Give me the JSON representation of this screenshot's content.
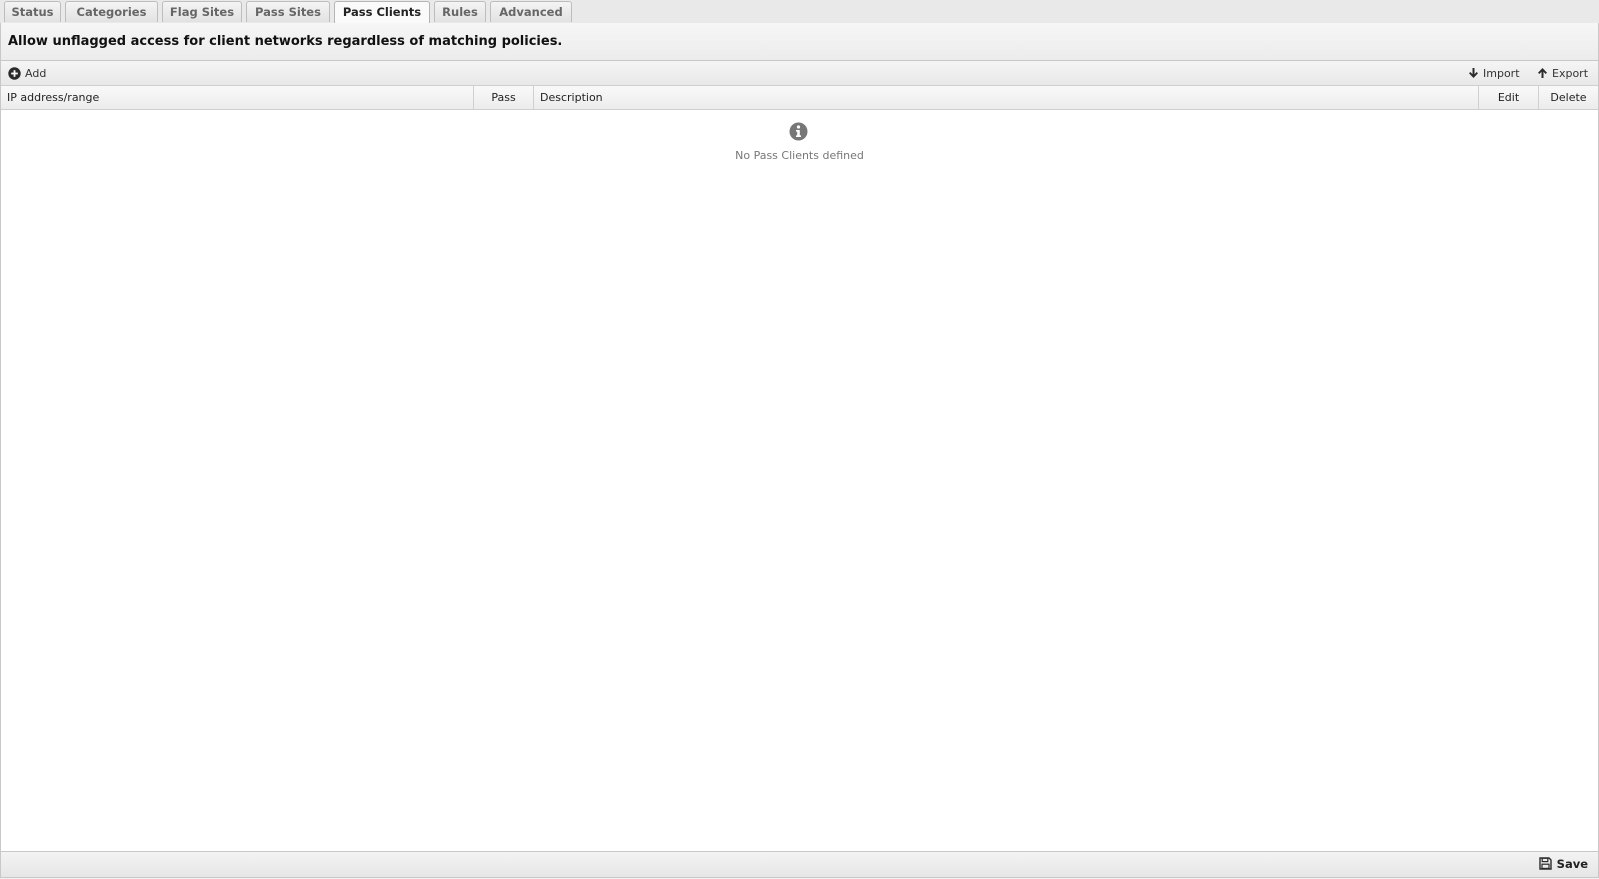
{
  "tabs": [
    {
      "label": "Status",
      "active": false
    },
    {
      "label": "Categories",
      "active": false
    },
    {
      "label": "Flag Sites",
      "active": false
    },
    {
      "label": "Pass Sites",
      "active": false
    },
    {
      "label": "Pass Clients",
      "active": true
    },
    {
      "label": "Rules",
      "active": false
    },
    {
      "label": "Advanced",
      "active": false
    }
  ],
  "panel": {
    "heading": "Allow unflagged access for client networks regardless of matching policies."
  },
  "toolbar": {
    "add_label": "Add",
    "import_label": "Import",
    "export_label": "Export"
  },
  "grid": {
    "columns": [
      "IP address/range",
      "Pass",
      "Description",
      "Edit",
      "Delete"
    ],
    "rows": [],
    "empty_text": "No Pass Clients defined"
  },
  "footer": {
    "save_label": "Save"
  },
  "icons": {
    "add": "plus-circle-icon",
    "import": "arrow-down-icon",
    "export": "arrow-up-icon",
    "empty": "info-circle-icon",
    "save": "floppy-disk-icon"
  }
}
